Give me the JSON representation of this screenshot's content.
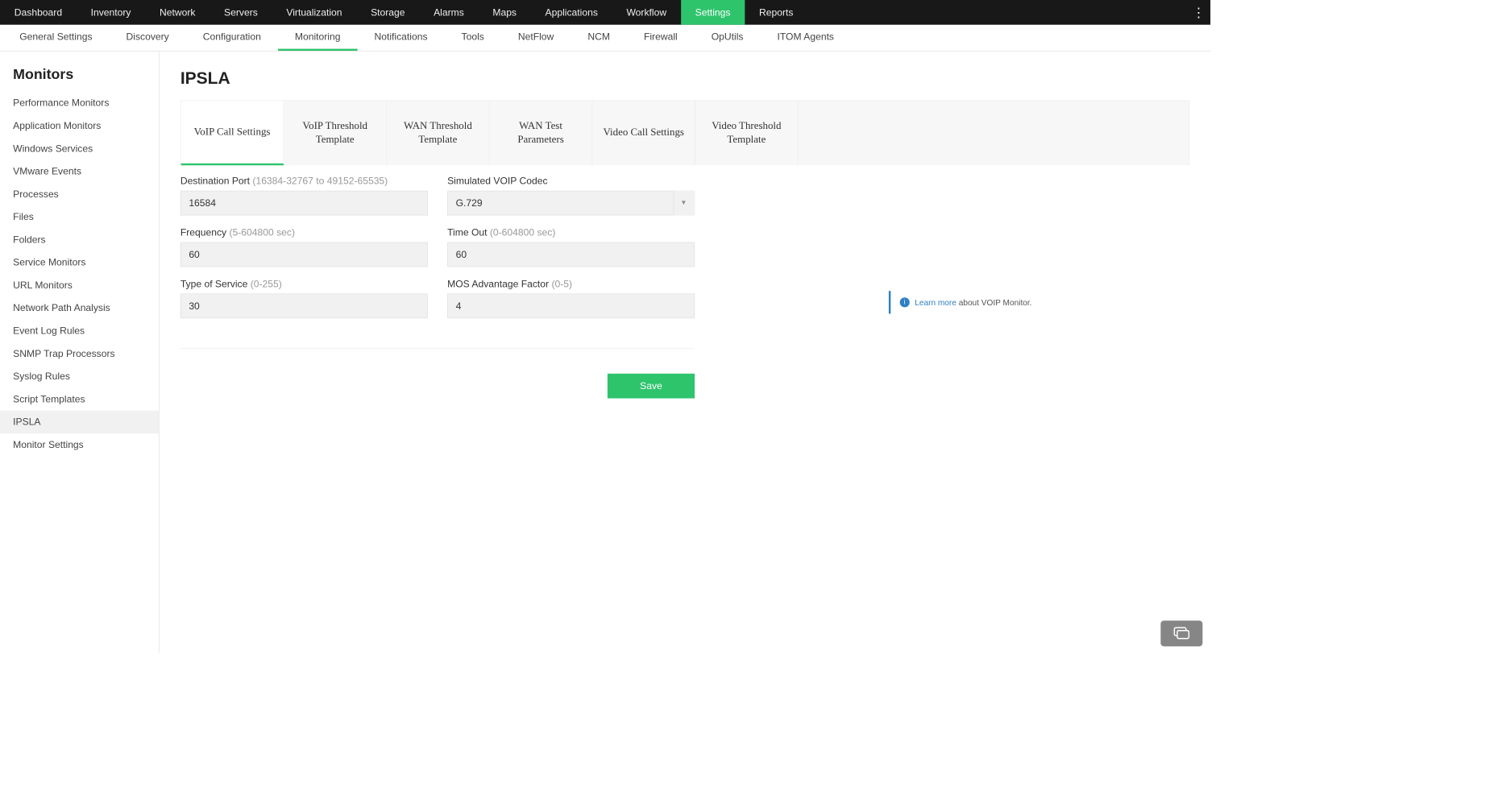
{
  "topnav": {
    "items": [
      "Dashboard",
      "Inventory",
      "Network",
      "Servers",
      "Virtualization",
      "Storage",
      "Alarms",
      "Maps",
      "Applications",
      "Workflow",
      "Settings",
      "Reports"
    ],
    "active": "Settings"
  },
  "subnav": {
    "items": [
      "General Settings",
      "Discovery",
      "Configuration",
      "Monitoring",
      "Notifications",
      "Tools",
      "NetFlow",
      "NCM",
      "Firewall",
      "OpUtils",
      "ITOM Agents"
    ],
    "active": "Monitoring"
  },
  "sidebar": {
    "title": "Monitors",
    "items": [
      "Performance Monitors",
      "Application Monitors",
      "Windows Services",
      "VMware Events",
      "Processes",
      "Files",
      "Folders",
      "Service Monitors",
      "URL Monitors",
      "Network Path Analysis",
      "Event Log Rules",
      "SNMP Trap Processors",
      "Syslog Rules",
      "Script Templates",
      "IPSLA",
      "Monitor Settings"
    ],
    "active": "IPSLA"
  },
  "page": {
    "title": "IPSLA"
  },
  "ctabs": {
    "items": [
      "VoIP Call Settings",
      "VoIP Threshold Template",
      "WAN Threshold Template",
      "WAN Test Parameters",
      "Video Call Settings",
      "Video Threshold Template"
    ],
    "active": "VoIP Call Settings"
  },
  "form": {
    "dest_port": {
      "label": "Destination Port ",
      "hint": "(16384-32767 to 49152-65535)",
      "value": "16584"
    },
    "codec": {
      "label": "Simulated VOIP Codec",
      "value": "G.729"
    },
    "freq": {
      "label": "Frequency ",
      "hint": "(5-604800 sec)",
      "value": "60"
    },
    "timeout": {
      "label": "Time Out ",
      "hint": "(0-604800 sec)",
      "value": "60"
    },
    "tos": {
      "label": "Type of Service ",
      "hint": "(0-255)",
      "value": "30"
    },
    "mos": {
      "label": "MOS Advantage Factor ",
      "hint": "(0-5)",
      "value": "4"
    }
  },
  "info": {
    "link": "Learn more",
    "text": " about VOIP Monitor."
  },
  "buttons": {
    "save": "Save"
  }
}
